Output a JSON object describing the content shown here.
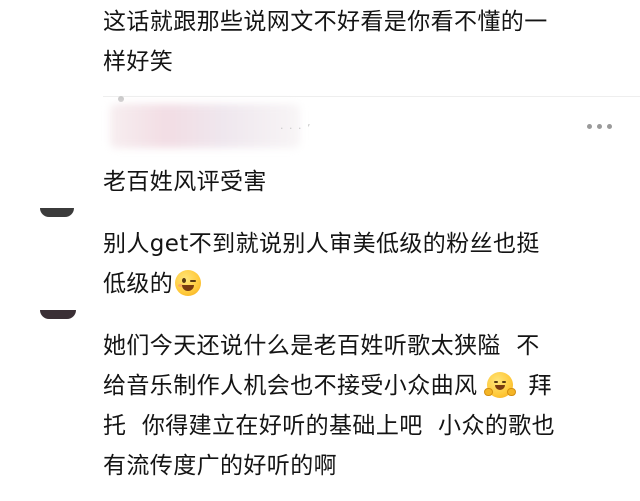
{
  "comments": [
    {
      "text": "这话就跟那些说网文不好看是你看不懂的一\n样好笑"
    },
    {
      "text": "老百姓风评受害",
      "meta_fragment": "· · ·  ’"
    },
    {
      "text_before_emoji": "别人get不到就说别人审美低级的粉丝也挺\n低级的",
      "emoji": "wink-face-icon"
    },
    {
      "text_before_emoji": "她们今天还说什么是老百姓听歌太狭隘  不\n给音乐制作人机会也不接受小众曲风 ",
      "emoji": "hugging-face-icon",
      "text_after_emoji": "  拜\n托  你得建立在好听的基础上吧  小众的歌也\n有流传度广的好听的啊"
    }
  ]
}
